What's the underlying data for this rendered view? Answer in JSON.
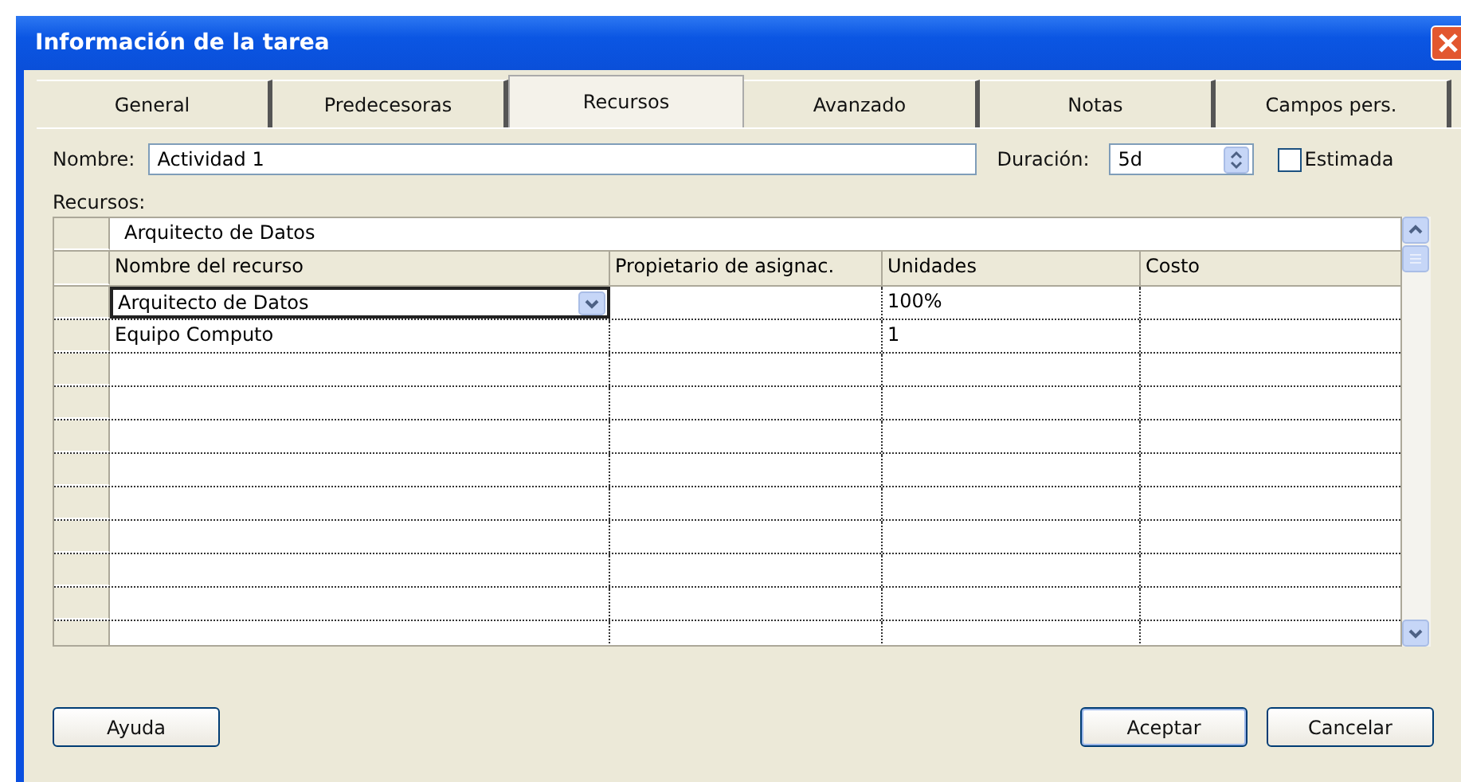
{
  "window": {
    "title": "Información de la tarea"
  },
  "tabs": [
    {
      "label": "General",
      "selected": false
    },
    {
      "label": "Predecesoras",
      "selected": false
    },
    {
      "label": "Recursos",
      "selected": true
    },
    {
      "label": "Avanzado",
      "selected": false
    },
    {
      "label": "Notas",
      "selected": false
    },
    {
      "label": "Campos pers.",
      "selected": false
    }
  ],
  "name_field": {
    "label": "Nombre:",
    "value": "Actividad 1"
  },
  "duration_field": {
    "label": "Duración:",
    "value": "5d"
  },
  "estimated": {
    "label": "Estimada",
    "checked": false
  },
  "resources": {
    "label": "Recursos:",
    "entry_value": "Arquitecto de Datos",
    "columns": [
      "Nombre del recurso",
      "Propietario de asignac.",
      "Unidades",
      "Costo"
    ],
    "rows": [
      {
        "cells": [
          "Arquitecto de Datos",
          "",
          "100%",
          ""
        ],
        "selected": true
      },
      {
        "cells": [
          "Equipo Computo",
          "",
          "1",
          ""
        ],
        "selected": false
      }
    ]
  },
  "buttons": [
    {
      "label": "Ayuda",
      "kind": "left"
    },
    {
      "label": "Aceptar",
      "kind": "default"
    },
    {
      "label": "Cancelar",
      "kind": "right"
    }
  ]
}
